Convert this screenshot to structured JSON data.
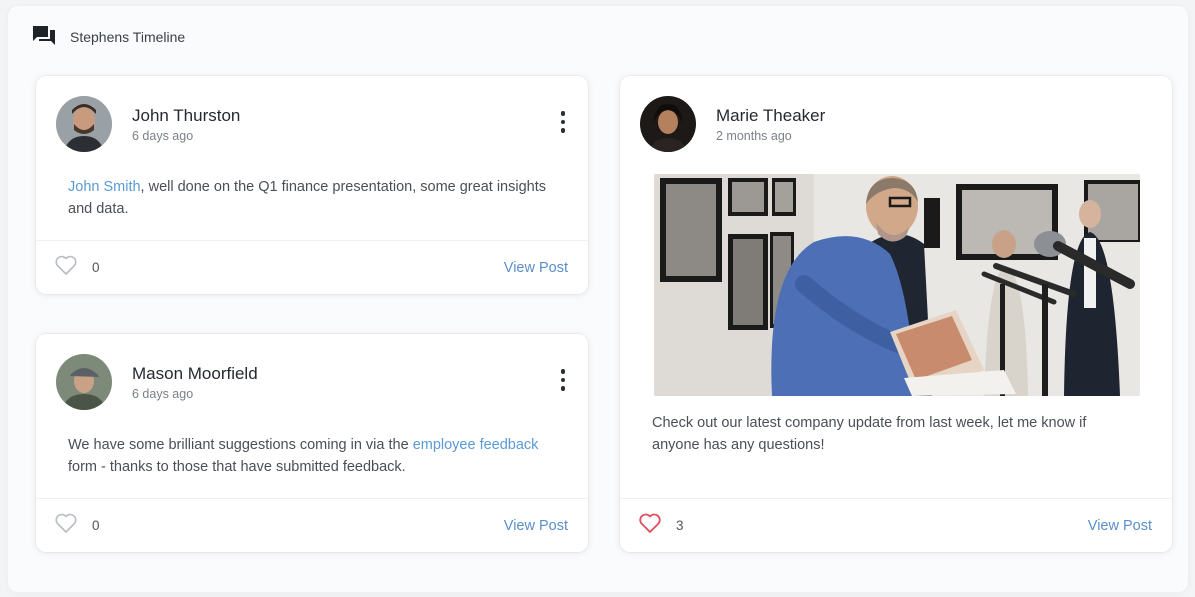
{
  "widget": {
    "title": "Stephens Timeline",
    "icon": "forum-icon"
  },
  "posts": [
    {
      "author": "John Thurston",
      "time": "6 days ago",
      "text_link": "John Smith",
      "text_after": ", well done on the Q1 finance presentation, some great insights and data.",
      "likes": "0",
      "liked": false,
      "view_label": "View Post"
    },
    {
      "author": "Mason Moorfield",
      "time": "6 days ago",
      "text_before": "We have some brilliant suggestions coming in via the ",
      "text_link": "employee feedback",
      "text_after": " form - thanks to those that have submitted feedback.",
      "likes": "0",
      "liked": false,
      "view_label": "View Post"
    },
    {
      "author": "Marie Theaker",
      "time": "2 months ago",
      "text": "Check out our latest company update from last week, let me know if anyone has any questions!",
      "likes": "3",
      "liked": true,
      "view_label": "View Post",
      "image": "photo of a man reading at a microphone in a gallery"
    }
  ],
  "colors": {
    "accent_link": "#5a9ad6",
    "view_post": "#5b8fc9",
    "liked_heart": "#e04f5f",
    "unliked_heart": "#b9bdc3"
  }
}
